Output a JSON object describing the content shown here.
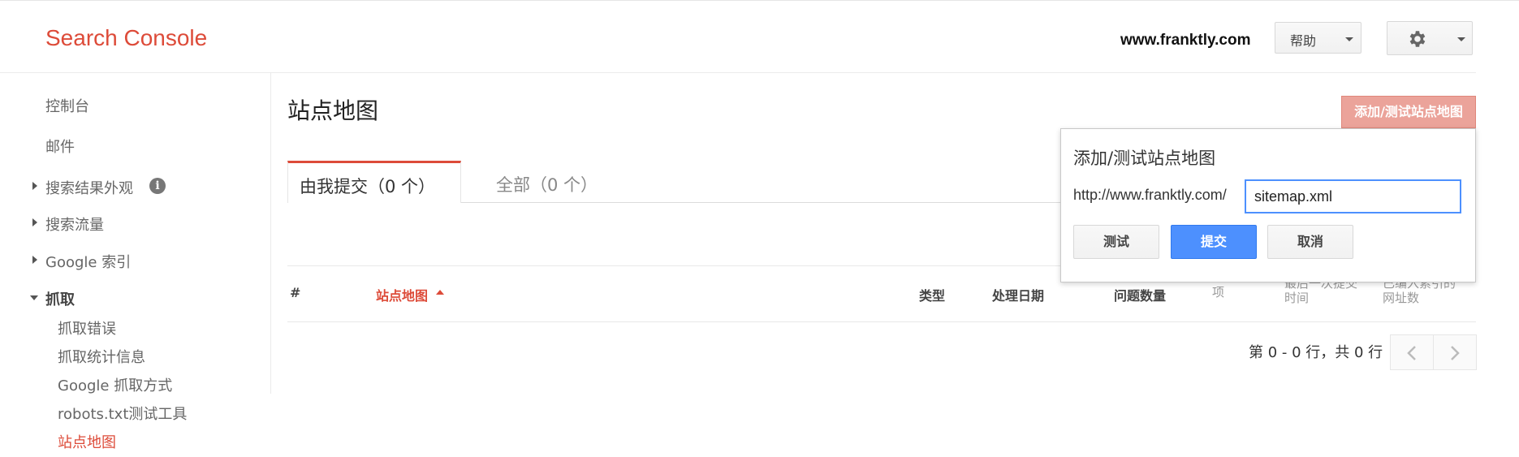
{
  "header": {
    "logo": "Search Console",
    "site": "www.franktly.com",
    "help_label": "帮助"
  },
  "sidebar": {
    "dashboard": "控制台",
    "messages": "邮件",
    "search_appearance": "搜索结果外观",
    "search_traffic": "搜索流量",
    "google_index": "Google 索引",
    "crawl": "抓取",
    "crawl_items": [
      "抓取错误",
      "抓取统计信息",
      "Google 抓取方式",
      "robots.txt测试工具",
      "站点地图"
    ]
  },
  "main": {
    "page_title": "站点地图",
    "add_test_button": "添加/测试站点地图",
    "tabs": [
      {
        "label": "由我提交（0 个）",
        "active": true
      },
      {
        "label": "全部（0 个）",
        "active": false
      }
    ],
    "table": {
      "columns": {
        "num": "#",
        "sitemap": "站点地图",
        "type": "类型",
        "processed": "处理日期",
        "issues": "问题数量",
        "items": "项",
        "last_submitted_1": "最后一次提交",
        "last_submitted_2": "时间",
        "indexed_1": "已编入索引的",
        "indexed_2": "网址数"
      }
    },
    "pager": "第 0 - 0 行，共 0 行"
  },
  "popup": {
    "title": "添加/测试站点地图",
    "prefix": "http://www.franktly.com/",
    "input_value": "sitemap.xml",
    "test_label": "测试",
    "submit_label": "提交",
    "cancel_label": "取消"
  },
  "colors": {
    "brand_red": "#dd4b39",
    "primary_blue": "#4d90fe"
  },
  "icons": [
    "settings-gear-icon",
    "dropdown-caret-icon",
    "info-icon",
    "expand-arrow-icon",
    "sort-ascending-icon",
    "chevron-left-icon",
    "chevron-right-icon"
  ]
}
